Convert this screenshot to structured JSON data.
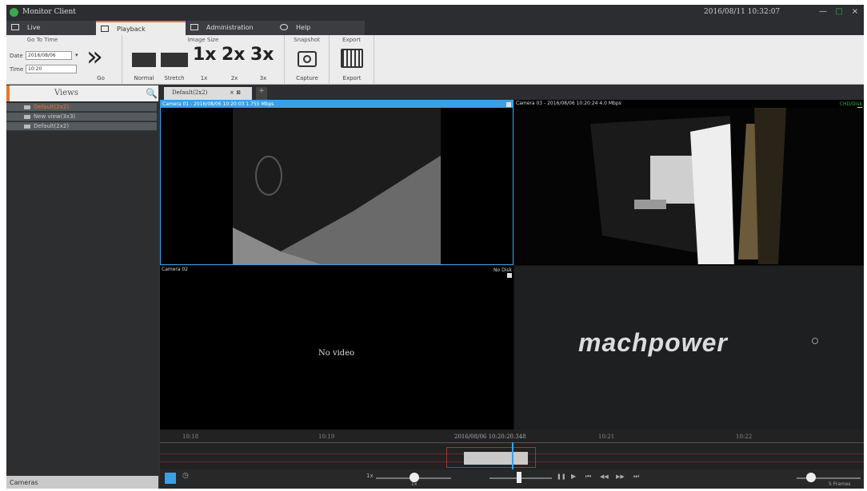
{
  "titlebar": {
    "title": "Monitor Client",
    "datetime": "2016/08/11 10:32:07",
    "min": "—",
    "max": "□",
    "close": "×"
  },
  "tabs": [
    {
      "label": "Live"
    },
    {
      "label": "Playback"
    },
    {
      "label": "Administration"
    },
    {
      "label": "Help"
    }
  ],
  "ribbon": {
    "goto": {
      "title": "Go To Time",
      "date_label": "Date",
      "date_value": "2016/08/06",
      "time_label": "Time",
      "time_value": "10:20",
      "go_label": "Go"
    },
    "image_size": {
      "title": "Image Size",
      "normal": "Normal",
      "stretch": "Stretch",
      "z1": "1x",
      "z2": "2x",
      "z3": "3x",
      "z1_big": "1x",
      "z2_big": "2x",
      "z3_big": "3x"
    },
    "snapshot": {
      "title": "Snapshot",
      "capture": "Capture"
    },
    "export": {
      "title": "Export",
      "label": "Export"
    }
  },
  "sidebar": {
    "views_title": "Views",
    "items": [
      {
        "label": "Default(2x2)"
      },
      {
        "label": "New view(3x3)"
      },
      {
        "label": "Default(2x2)"
      }
    ],
    "cameras_label": "Cameras"
  },
  "viewtab": {
    "label": "Default(2x2)",
    "close": "× ⊠",
    "add": "+"
  },
  "panes": {
    "p1_caption": "Camera 01 - 2016/08/06 10:20:03 1.755 Mbps",
    "p2_caption": "Camera 03 - 2016/08/06 10:20:24 4.0 Mbps",
    "p2_flag": "CHD/Disk",
    "p3_caption": "Camera 02",
    "p3_flag": "No Disk",
    "no_video": "No video",
    "brand": "machpower"
  },
  "timeline": {
    "ticks": [
      "10:18",
      "10:19",
      "10:20",
      "10:21",
      "10:22"
    ],
    "cursor_label": "2016/08/06 10:20:20.348"
  },
  "controls": {
    "speed_label": "1x",
    "speed_value": "1x",
    "frames_label": "5 Frames",
    "play": "▶",
    "pause": "❚❚",
    "prev": "⏮",
    "rew": "◀◀",
    "ffw": "▶▶",
    "next": "⏭"
  },
  "colors": {
    "accent": "#e8762c",
    "selection": "#3aa0e6"
  }
}
